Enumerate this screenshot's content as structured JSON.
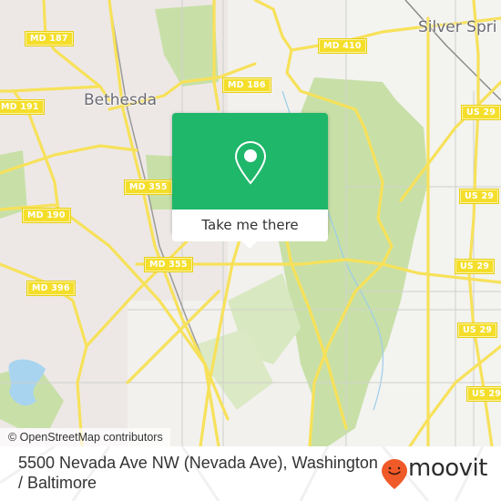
{
  "map": {
    "city_labels": [
      {
        "id": "bethesda",
        "text": "Bethesda"
      },
      {
        "id": "silver-spring",
        "text": "Silver Spri"
      }
    ],
    "route_shields": [
      {
        "id": "md187",
        "text": "MD 187"
      },
      {
        "id": "md191",
        "text": "MD 191"
      },
      {
        "id": "md186",
        "text": "MD 186"
      },
      {
        "id": "md410",
        "text": "MD 410"
      },
      {
        "id": "md355a",
        "text": "MD 355"
      },
      {
        "id": "md190",
        "text": "MD 190"
      },
      {
        "id": "md355b",
        "text": "MD 355"
      },
      {
        "id": "md396",
        "text": "MD 396"
      },
      {
        "id": "us29a",
        "text": "US 29"
      },
      {
        "id": "us29b",
        "text": "US 29"
      },
      {
        "id": "us29c",
        "text": "US 29"
      },
      {
        "id": "us29d",
        "text": "US 29"
      },
      {
        "id": "us29e",
        "text": "US 29"
      }
    ],
    "attribution": "© OpenStreetMap contributors",
    "colors": {
      "road": "#f7e15a",
      "park": "#c8e0a8",
      "water": "#a8d4ef",
      "land": "#f2f1ee"
    }
  },
  "popup": {
    "button_label": "Take me there",
    "icon": "map-pin-icon",
    "color": "#1fb76a"
  },
  "footer": {
    "address": "5500 Nevada Ave NW (Nevada Ave), Washington / Baltimore",
    "brand": "moovit",
    "brand_color": "#f05a28"
  }
}
